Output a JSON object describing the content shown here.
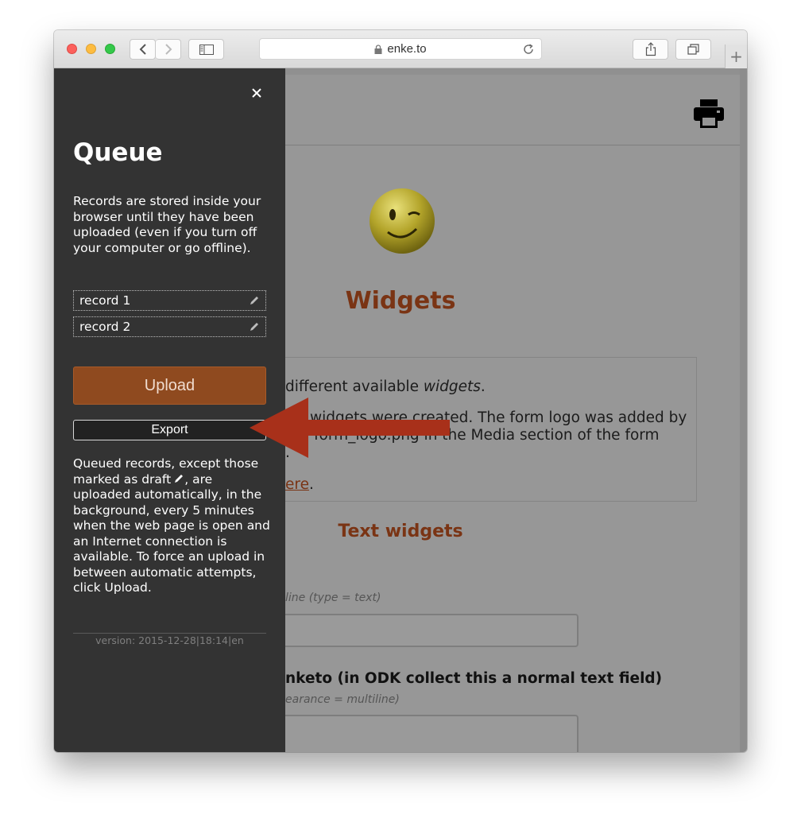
{
  "browser": {
    "url": "enke.to",
    "new_tab_symbol": "+"
  },
  "panel": {
    "title": "Queue",
    "description": "Records are stored inside your browser until they have been uploaded (even if you turn off your computer or go offline).",
    "records": [
      {
        "label": "record 1"
      },
      {
        "label": "record 2"
      }
    ],
    "upload_label": "Upload",
    "export_label": "Export",
    "info_before_icon": "Queued records, except those marked as draft",
    "info_after_icon": ", are uploaded automatically, in the background, every 5 minutes when the web page is open and an Internet connection is available. To force an upload in between automatic attempts, click Upload.",
    "version": "version: 2015-12-28|18:14|en"
  },
  "page": {
    "title": "Widgets",
    "intro_line1_a": "different available ",
    "intro_line1_em": "widgets",
    "intro_line1_b": ".",
    "intro_line2": "widgets were created. The form logo was added by",
    "intro_line3": "form_logo.png in the Media section of the form",
    "intro_line4_dot": ".",
    "intro_link_text": "ere",
    "intro_link_after": ".",
    "section_title": "Text widgets",
    "hint1": "line (type = text)",
    "question2_label": "nketo (in ODK collect this a normal text field)",
    "hint2": "earance = multiline)"
  },
  "colors": {
    "accent": "#7a3414",
    "upload_bg": "#8f4a1f",
    "arrow": "#a8301a",
    "panel_bg": "#333333"
  },
  "icons": [
    "lock-icon",
    "reload-icon",
    "back-icon",
    "forward-icon",
    "sidebar-icon",
    "share-icon",
    "tabs-icon",
    "close-icon",
    "pencil-icon",
    "print-icon",
    "wink-smiley-logo",
    "red-arrow-annotation"
  ]
}
